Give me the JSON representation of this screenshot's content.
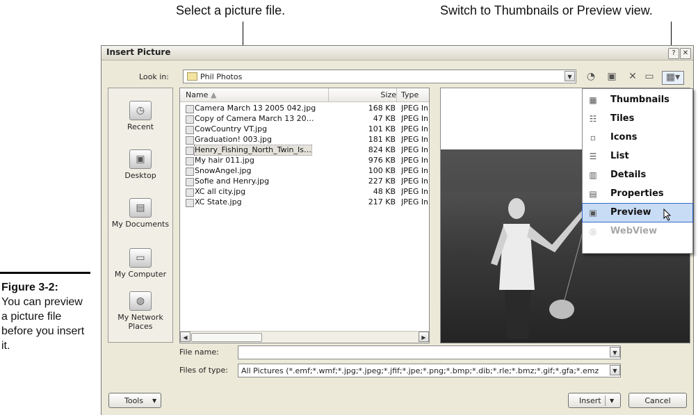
{
  "callouts": {
    "left": "Select a picture file.",
    "right": "Switch to Thumbnails or Preview view."
  },
  "figure": {
    "label": "Figure 3-2:",
    "caption": "You can preview a picture file before you insert it."
  },
  "dialog": {
    "title": "Insert Picture",
    "help": "?",
    "close": "✕",
    "look_in_label": "Look in:",
    "look_in_value": "Phil Photos",
    "places": [
      "Recent",
      "Desktop",
      "My Documents",
      "My Computer",
      "My Network Places"
    ],
    "columns": {
      "name": "Name",
      "size": "Size",
      "type": "Type"
    },
    "files": [
      {
        "name": "Camera March 13 2005 042.jpg",
        "size": "168 KB",
        "type": "JPEG Ima"
      },
      {
        "name": "Copy of Camera March 13 20…",
        "size": "47 KB",
        "type": "JPEG Ima"
      },
      {
        "name": "CowCountry VT.jpg",
        "size": "101 KB",
        "type": "JPEG Ima"
      },
      {
        "name": "Graduation! 003.jpg",
        "size": "181 KB",
        "type": "JPEG Ima"
      },
      {
        "name": "Henry_Fishing_North_Twin_Is…",
        "size": "824 KB",
        "type": "JPEG Ima"
      },
      {
        "name": "My hair 011.jpg",
        "size": "976 KB",
        "type": "JPEG Ima"
      },
      {
        "name": "SnowAngel.jpg",
        "size": "100 KB",
        "type": "JPEG Ima"
      },
      {
        "name": "Sofie and Henry.jpg",
        "size": "227 KB",
        "type": "JPEG Ima"
      },
      {
        "name": "XC all city.jpg",
        "size": "48 KB",
        "type": "JPEG Ima"
      },
      {
        "name": "XC State.jpg",
        "size": "217 KB",
        "type": "JPEG Ima"
      }
    ],
    "selected_file": "Henry_Fishing_North_Twin_Is…",
    "views_menu": [
      {
        "label": "Thumbnails",
        "icon": "thumbnails-icon"
      },
      {
        "label": "Tiles",
        "icon": "tiles-icon"
      },
      {
        "label": "Icons",
        "icon": "icons-icon"
      },
      {
        "label": "List",
        "icon": "list-icon"
      },
      {
        "label": "Details",
        "icon": "details-icon"
      },
      {
        "label": "Properties",
        "icon": "properties-icon"
      },
      {
        "label": "Preview",
        "icon": "preview-icon"
      },
      {
        "label": "WebView",
        "icon": "webview-icon"
      }
    ],
    "file_name_label": "File name:",
    "file_name_value": "",
    "files_of_type_label": "Files of type:",
    "files_of_type_value": "All Pictures (*.emf;*.wmf;*.jpg;*.jpeg;*.jfif;*.jpe;*.png;*.bmp;*.dib;*.rle;*.bmz;*.gif;*.gfa;*.emz",
    "tools_button": "Tools",
    "insert_button": "Insert",
    "cancel_button": "Cancel"
  }
}
